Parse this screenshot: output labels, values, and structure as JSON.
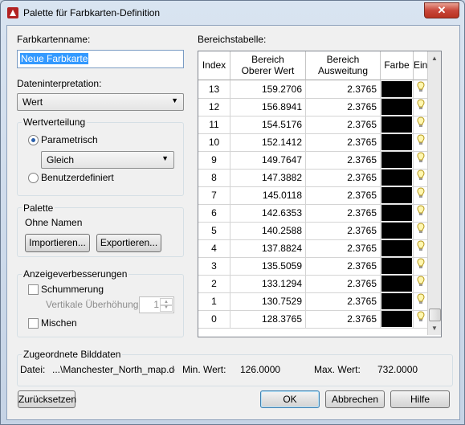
{
  "window": {
    "title": "Palette für Farbkarten-Definition",
    "close": "✕"
  },
  "left": {
    "name_label": "Farbkartenname:",
    "name_value": "Neue Farbkarte",
    "interp_label": "Dateninterpretation:",
    "interp_value": "Wert",
    "distribution": {
      "title": "Wertverteilung",
      "parametric": "Parametrisch",
      "parametric_selected": true,
      "method_value": "Gleich",
      "user_defined": "Benutzerdefiniert"
    },
    "palette": {
      "title": "Palette",
      "name": "Ohne Namen",
      "import_button": "Importieren...",
      "export_button": "Exportieren..."
    },
    "display": {
      "title": "Anzeigeverbesserungen",
      "shading": "Schummerung",
      "vertical_label": "Vertikale Überhöhung",
      "vertical_value": "1",
      "blend": "Mischen"
    }
  },
  "table": {
    "title": "Bereichstabelle:",
    "headers": {
      "index": "Index",
      "upper": [
        "Bereich",
        "Oberer Wert"
      ],
      "span": [
        "Bereich",
        "Ausweitung"
      ],
      "color": "Farbe",
      "on": "Ein"
    },
    "rows": [
      {
        "index": "13",
        "upper": "159.2706",
        "span": "2.3765"
      },
      {
        "index": "12",
        "upper": "156.8941",
        "span": "2.3765"
      },
      {
        "index": "11",
        "upper": "154.5176",
        "span": "2.3765"
      },
      {
        "index": "10",
        "upper": "152.1412",
        "span": "2.3765"
      },
      {
        "index": "9",
        "upper": "149.7647",
        "span": "2.3765"
      },
      {
        "index": "8",
        "upper": "147.3882",
        "span": "2.3765"
      },
      {
        "index": "7",
        "upper": "145.0118",
        "span": "2.3765"
      },
      {
        "index": "6",
        "upper": "142.6353",
        "span": "2.3765"
      },
      {
        "index": "5",
        "upper": "140.2588",
        "span": "2.3765"
      },
      {
        "index": "4",
        "upper": "137.8824",
        "span": "2.3765"
      },
      {
        "index": "3",
        "upper": "135.5059",
        "span": "2.3765"
      },
      {
        "index": "2",
        "upper": "133.1294",
        "span": "2.3765"
      },
      {
        "index": "1",
        "upper": "130.7529",
        "span": "2.3765"
      },
      {
        "index": "0",
        "upper": "128.3765",
        "span": "2.3765"
      }
    ],
    "swatch_color": "#000000",
    "bulb_icon": "lightbulb-icon"
  },
  "assigned": {
    "title": "Zugeordnete Bilddaten",
    "file_label": "Datei:",
    "file_value": "...\\Manchester_North_map.dem",
    "min_label": "Min. Wert:",
    "min_value": "126.0000",
    "max_label": "Max. Wert:",
    "max_value": "732.0000"
  },
  "buttons": {
    "reset": "Zurücksetzen",
    "ok": "OK",
    "cancel": "Abbrechen",
    "help": "Hilfe"
  }
}
